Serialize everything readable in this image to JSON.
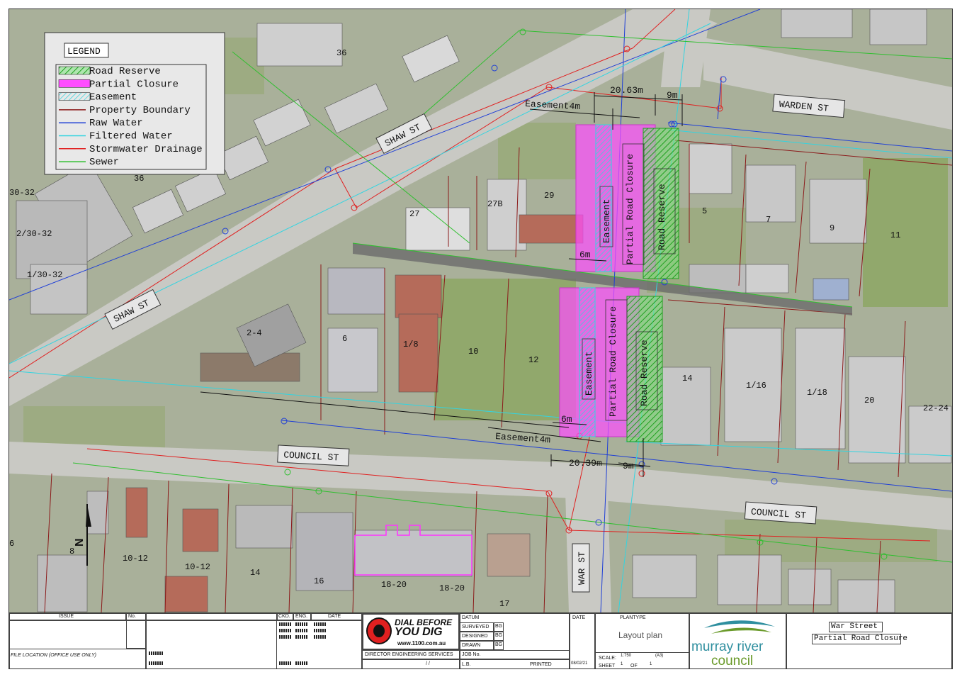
{
  "legend": {
    "title": "LEGEND",
    "items": [
      {
        "label": "Road Reserve",
        "swatch": "hatch-green"
      },
      {
        "label": "Partial Closure",
        "swatch": "magenta"
      },
      {
        "label": "Easement",
        "swatch": "hatch-cyan"
      },
      {
        "label": "Property Boundary",
        "swatch": "line",
        "color": "#8b1a1a"
      },
      {
        "label": "Raw Water",
        "swatch": "line",
        "color": "#1f3fd6"
      },
      {
        "label": "Filtered Water",
        "swatch": "line",
        "color": "#33d4e0"
      },
      {
        "label": "Stormwater Drainage",
        "swatch": "line",
        "color": "#e02020"
      },
      {
        "label": "Sewer",
        "swatch": "line",
        "color": "#2fbf2f"
      }
    ]
  },
  "streets": {
    "shaw_1": "SHAW ST",
    "shaw_2": "SHAW ST",
    "warden": "WARDEN ST",
    "council_1": "COUNCIL ST",
    "council_2": "COUNCIL ST",
    "war": "WAR ST"
  },
  "lots": [
    "36",
    "36",
    "30-32",
    "2/30-32",
    "1/30-32",
    "27",
    "27B",
    "29",
    "5",
    "7",
    "9",
    "11",
    "2-4",
    "6",
    "1/8",
    "10",
    "12",
    "14",
    "1/16",
    "1/18",
    "20",
    "22-24",
    "8",
    "10-12",
    "10-12",
    "14",
    "16",
    "18-20",
    "18-20",
    "17",
    "6"
  ],
  "zone_labels": {
    "easement_north": "Easement",
    "closure_north": "Partial Road Closure",
    "reserve_north": "Road Reserve",
    "easement_south": "Easement",
    "closure_south": "Partial Road Closure",
    "reserve_south": "Road Reserve"
  },
  "dimensions": {
    "north_width": "20.63m",
    "north_reserve": "9m",
    "north_easement": "Easement4m",
    "north_6m": "6m",
    "south_width": "20.39m",
    "south_reserve": "9m",
    "south_easement": "Easement4m",
    "south_6m": "6m"
  },
  "title_block": {
    "issue": "ISSUE",
    "no": "No.",
    "ckd": "CKD.",
    "eng": "ENG.",
    "date": "DATE",
    "file_location": "FILE LOCATION (OFFICE USE ONLY)",
    "dbyd_line1": "DIAL BEFORE",
    "dbyd_line2": "YOU DIG",
    "dbyd_url": "www.1100.com.au",
    "director": "DIRECTOR ENGINEERING SERVICES",
    "datum": "DATUM",
    "surveyed": "SURVEYED",
    "designed": "DESIGNED",
    "drawn": "DRAWN",
    "job_no": "JOB No.",
    "lb": "L.B.",
    "printed": "PRINTED",
    "date2": "DATE",
    "date_value": "08/02/21",
    "surveyed_val": "BG",
    "designed_val": "BG",
    "drawn_val": "BG",
    "plantype": "PLANTYPE",
    "plantype_value": "Layout plan",
    "scale": "SCALE:",
    "scale_value": "1:750",
    "paper": "(A3)",
    "sheet": "SHEET",
    "sheet_no": "1",
    "of": "OF",
    "sheet_total": "1",
    "council_line1": "murray river",
    "council_line2": "council",
    "project_line1": "War Street",
    "project_line2": "Partial Road Closure",
    "slash": "/     /"
  },
  "colors": {
    "property_boundary": "#8b1a1a",
    "raw_water": "#1f3fd6",
    "filtered_water": "#33d4e0",
    "stormwater": "#e02020",
    "sewer": "#2fbf2f",
    "partial_closure": "#ff4dff",
    "road_reserve": "#3fcf3f",
    "council_teal": "#2f8f9f",
    "council_green": "#6a9a2a"
  }
}
